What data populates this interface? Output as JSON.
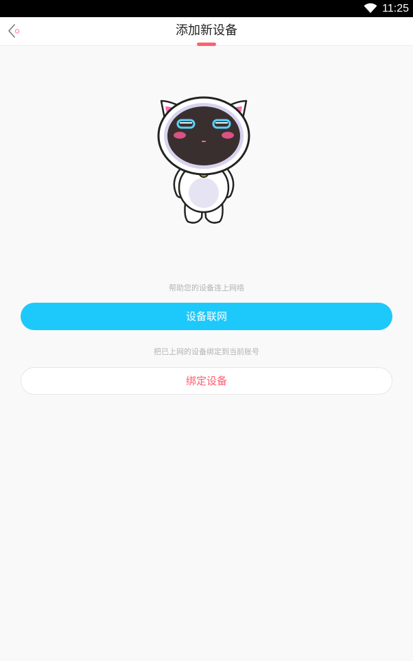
{
  "status_bar": {
    "time": "11:25",
    "wifi_icon": "wifi-icon"
  },
  "header": {
    "title": "添加新设备",
    "back_icon": "back-arrow-icon",
    "accent_color": "#ff6070"
  },
  "illustration": {
    "name": "robot-cat-mascot"
  },
  "network": {
    "hint": "帮助您的设备连上网络",
    "button_label": "设备联网",
    "button_color": "#1dc8fb"
  },
  "bind": {
    "hint": "把已上网的设备绑定到当前账号",
    "button_label": "绑定设备",
    "text_color": "#ff5c6e"
  }
}
